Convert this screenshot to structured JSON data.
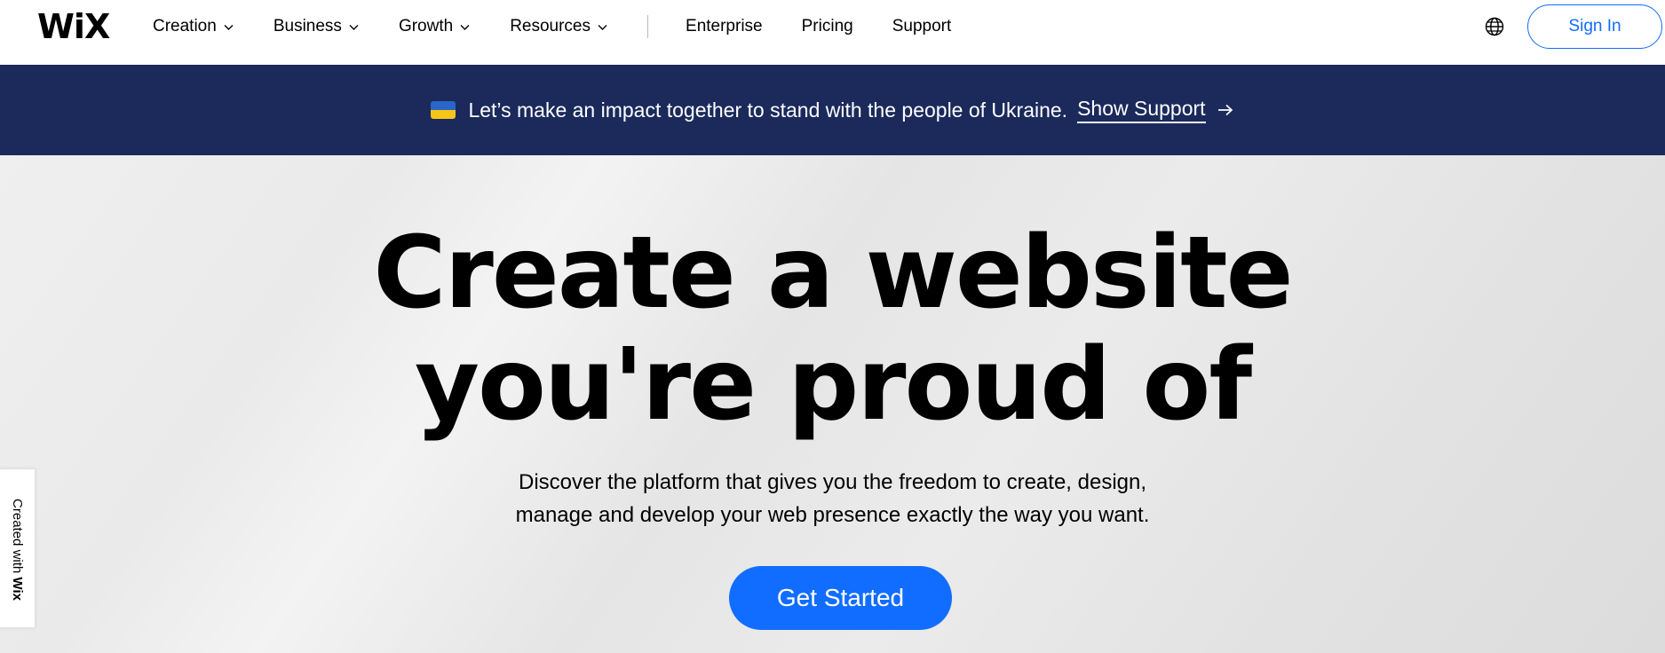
{
  "header": {
    "logo": "WiX",
    "nav": [
      {
        "label": "Creation",
        "dropdown": true
      },
      {
        "label": "Business",
        "dropdown": true
      },
      {
        "label": "Growth",
        "dropdown": true
      },
      {
        "label": "Resources",
        "dropdown": true
      }
    ],
    "nav_plain": [
      "Enterprise",
      "Pricing",
      "Support"
    ],
    "globe_icon": "globe-icon",
    "sign_in": "Sign In"
  },
  "banner": {
    "flag_icon": "ukraine-flag-icon",
    "message": "Let’s make an impact together to stand with the people of Ukraine.",
    "link": "Show Support",
    "arrow_icon": "arrow-right-icon"
  },
  "hero": {
    "title_line1": "Create a website",
    "title_line2": "you're proud of",
    "subtitle_line1": "Discover the platform that gives you the freedom to create, design,",
    "subtitle_line2": "manage and develop your web presence exactly the way you want.",
    "cta": "Get Started"
  },
  "side_badge": {
    "prefix": "Created with",
    "brand": "Wix"
  },
  "colors": {
    "accent": "#116dff",
    "banner_bg": "#1b2a5b",
    "hero_bg": "#e8e8e8"
  }
}
